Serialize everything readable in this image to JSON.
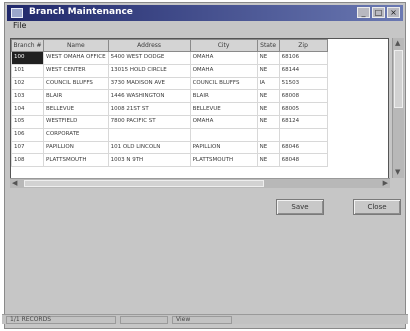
{
  "window": {
    "title": "Branch Maintenance",
    "buttons": [
      "_",
      "□",
      "×"
    ]
  },
  "menu": {
    "label": "File"
  },
  "grid": {
    "columns": [
      "Branch #",
      "Name",
      "Address",
      "City",
      "State",
      "Zip"
    ],
    "rows": [
      [
        "100",
        "WEST OMAHA OFFICE",
        "5400 WEST DODGE",
        "OMAHA",
        "NE",
        "68106"
      ],
      [
        "101",
        "WEST CENTER",
        "13015 HOLD CIRCLE",
        "OMAHA",
        "NE",
        "68144"
      ],
      [
        "102",
        "COUNCIL BLUFFS",
        "3730 MADISON AVE",
        "COUNCIL BLUFFS",
        "IA",
        "51503"
      ],
      [
        "103",
        "BLAIR",
        "1446 WASHINGTON",
        "BLAIR",
        "NE",
        "68008"
      ],
      [
        "104",
        "BELLEVUE",
        "1008 21ST ST",
        "BELLEVUE",
        "NE",
        "68005"
      ],
      [
        "105",
        "WESTFIELD",
        "7800 PACIFIC ST",
        "OMAHA",
        "NE",
        "68124"
      ],
      [
        "106",
        "CORPORATE",
        "",
        "",
        "",
        ""
      ],
      [
        "107",
        "PAPILLION",
        "101 OLD LINCOLN",
        "PAPILLION",
        "NE",
        "68046"
      ],
      [
        "108",
        "PLATTSMOUTH",
        "1003 N 9TH",
        "PLATTSMOUTH",
        "NE",
        "68048"
      ]
    ],
    "selected_row": 0
  },
  "actions": {
    "save_label": "Save",
    "close_label": "Close"
  },
  "statusbar": {
    "panel1": "1/1 RECORDS",
    "panel2": "",
    "panel3": "View"
  }
}
